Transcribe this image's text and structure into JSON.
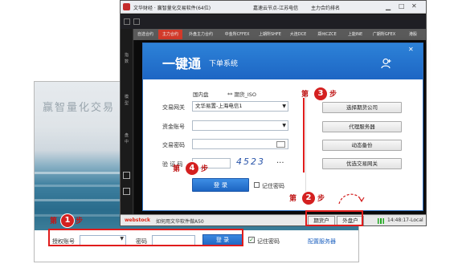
{
  "auth_window": {
    "bg_text": "赢智量化交易",
    "login": {
      "account_label": "授权账号",
      "password_label": "密码",
      "login_button": "登 录",
      "remember_label": "记住密码",
      "config_server_link": "配置服务器"
    }
  },
  "trading_window": {
    "title": "文华财经 · 赢智量化交易软件(64位)",
    "title_extra": "嘉速云节点-江苏电信",
    "title_extra2": "主力合约排名",
    "tabs": [
      "自选合约",
      "主力合约",
      "外盘主力合约",
      "中金所CFFEX",
      "上期所SHFE",
      "大连DCE",
      "郑州CZCE",
      "上能INE",
      "广期所GFEX",
      "港股"
    ],
    "left_tabs": [
      "指",
      "数",
      "模",
      "型",
      "盘",
      "中"
    ],
    "status_brand": "webstock",
    "status_text": "如何用文华软件做A50",
    "futures_account_button": "期货户",
    "external_account_button": "外盘户",
    "clock": "14:48:17-Local"
  },
  "dialog": {
    "title_main": "一键通",
    "title_sub": "下单系统",
    "market_domestic": "国内盘",
    "market_other": "** 期货_ISO",
    "gateway_label": "交易网关",
    "gateway_value": "文华易置-上海电信1",
    "account_label": "资金账号",
    "password_label": "交易密码",
    "captcha_label": "验 证 码",
    "captcha_value": "4523",
    "captcha_more": "...",
    "login_button": "登 录",
    "remember_label": "记住密码",
    "buttons": [
      "选择期货公司",
      "代理服务器",
      "动态备份",
      "优选交易网关"
    ]
  },
  "steps": [
    {
      "prefix": "第",
      "num": "1",
      "suffix": "步"
    },
    {
      "prefix": "第",
      "num": "2",
      "suffix": "步"
    },
    {
      "prefix": "第",
      "num": "3",
      "suffix": "步"
    },
    {
      "prefix": "第",
      "num": "4",
      "suffix": "步"
    }
  ],
  "colors": {
    "accent": "#1e6cc8",
    "step_red": "#d42020"
  }
}
